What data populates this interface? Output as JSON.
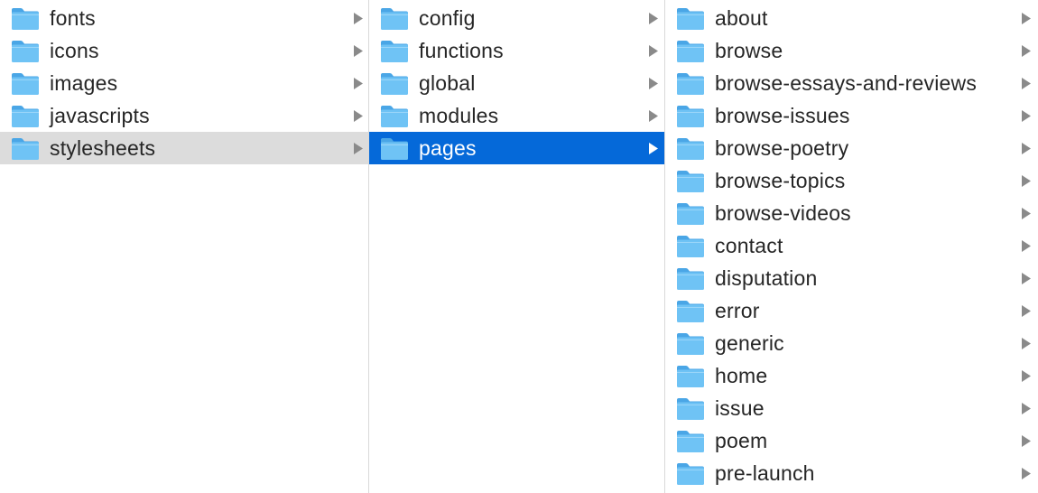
{
  "colors": {
    "folder_body": "#6fc3f5",
    "folder_tab": "#4aa6e6",
    "selected_active": "#0569d9",
    "selected_inactive": "#dcdcdc",
    "chevron": "#8a8a8a"
  },
  "columns": [
    {
      "items": [
        {
          "label": "fonts",
          "icon": "folder-icon",
          "state": "normal"
        },
        {
          "label": "icons",
          "icon": "folder-icon",
          "state": "normal"
        },
        {
          "label": "images",
          "icon": "folder-icon",
          "state": "normal"
        },
        {
          "label": "javascripts",
          "icon": "folder-icon",
          "state": "normal"
        },
        {
          "label": "stylesheets",
          "icon": "folder-icon",
          "state": "selected-inactive"
        }
      ]
    },
    {
      "items": [
        {
          "label": "config",
          "icon": "folder-icon",
          "state": "normal"
        },
        {
          "label": "functions",
          "icon": "folder-icon",
          "state": "normal"
        },
        {
          "label": "global",
          "icon": "folder-icon",
          "state": "normal"
        },
        {
          "label": "modules",
          "icon": "folder-icon",
          "state": "normal"
        },
        {
          "label": "pages",
          "icon": "folder-icon",
          "state": "selected-active"
        }
      ]
    },
    {
      "items": [
        {
          "label": "about",
          "icon": "folder-icon",
          "state": "normal"
        },
        {
          "label": "browse",
          "icon": "folder-icon",
          "state": "normal"
        },
        {
          "label": "browse-essays-and-reviews",
          "icon": "folder-icon",
          "state": "normal"
        },
        {
          "label": "browse-issues",
          "icon": "folder-icon",
          "state": "normal"
        },
        {
          "label": "browse-poetry",
          "icon": "folder-icon",
          "state": "normal"
        },
        {
          "label": "browse-topics",
          "icon": "folder-icon",
          "state": "normal"
        },
        {
          "label": "browse-videos",
          "icon": "folder-icon",
          "state": "normal"
        },
        {
          "label": "contact",
          "icon": "folder-icon",
          "state": "normal"
        },
        {
          "label": "disputation",
          "icon": "folder-icon",
          "state": "normal"
        },
        {
          "label": "error",
          "icon": "folder-icon",
          "state": "normal"
        },
        {
          "label": "generic",
          "icon": "folder-icon",
          "state": "normal"
        },
        {
          "label": "home",
          "icon": "folder-icon",
          "state": "normal"
        },
        {
          "label": "issue",
          "icon": "folder-icon",
          "state": "normal"
        },
        {
          "label": "poem",
          "icon": "folder-icon",
          "state": "normal"
        },
        {
          "label": "pre-launch",
          "icon": "folder-icon",
          "state": "normal"
        }
      ]
    }
  ]
}
